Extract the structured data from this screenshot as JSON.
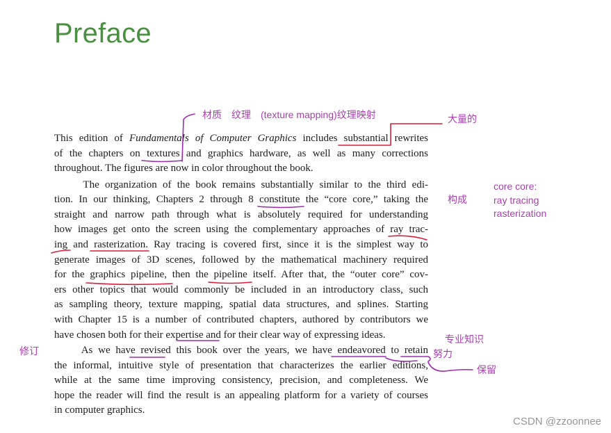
{
  "page_title": "Preface",
  "lines": [
    "This edition of <i>Fundamentals of Computer Graphics</i> includes substantial rewrites",
    "of the chapters on textures and graphics hardware, as well as many corrections",
    "throughout. The figures are now in color throughout the book.",
    "&nbsp;&nbsp;&nbsp;&nbsp;&nbsp;The organization of the book remains substantially similar to the third edi-",
    "tion. In our thinking, Chapters 2 through 8 constitute the “core core,” taking the",
    "straight and narrow path through what is absolutely required for understanding",
    "how images get onto the screen using the complementary approaches of ray trac-",
    "ing and rasterization. Ray tracing is covered first, since it is the simplest way to",
    "generate images of 3D scenes, followed by the mathematical machinery required",
    "for the graphics pipeline, then the pipeline itself. After that, the “outer core” cov-",
    "ers other topics that would commonly be included in an introductory class, such",
    "as sampling theory, texture mapping, spatial data structures, and splines. Starting",
    "with Chapter 15 is a number of contributed chapters, authored by contributors we",
    "have chosen both for their expertise and for their clear way of expressing ideas.",
    "&nbsp;&nbsp;&nbsp;&nbsp;&nbsp;As we have revised this book over the years, we have endeavored to retain",
    "the informal, intuitive style of presentation that characterizes the earlier editions,",
    "while at the same time improving consistency, precision, and completeness. We",
    "hope the reader will find the result is an appealing platform for a variety of courses",
    "in computer graphics."
  ],
  "annotations": {
    "texture_note": "材质　纹理　(texture mapping)纹理映射",
    "substantial_note": "大量的",
    "constitute_note": "构成",
    "core_note_1": "core core:",
    "core_note_2": "ray tracing",
    "core_note_3": "rasterization",
    "expertise_note": "专业知识",
    "endeavored_note": "努力",
    "revised_note": "修订",
    "retain_note": "保留"
  },
  "watermark": "CSDN @zzoonnee",
  "colors": {
    "title_green": "#4a8f42",
    "note_purple": "#a73fae",
    "underline_red": "#d81e3c",
    "underline_purple": "#9b2bb0",
    "body_text": "#1d1d1d"
  }
}
